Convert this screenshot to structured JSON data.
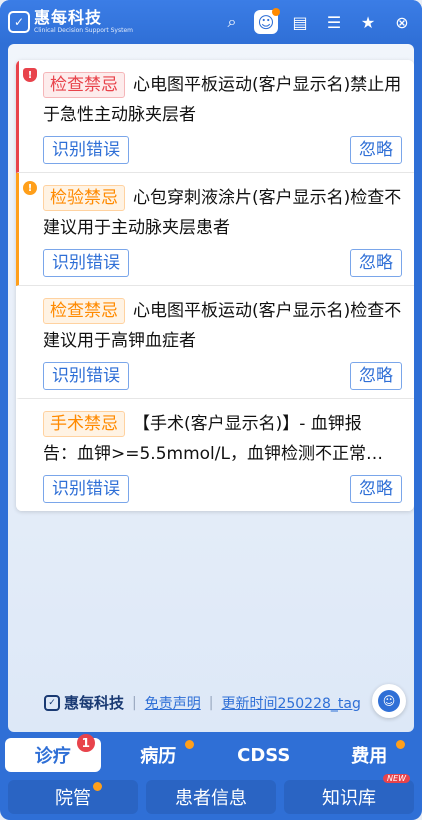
{
  "app": {
    "name": "惠每科技",
    "subtitle": "Clinical Decision Support System"
  },
  "toolbar": {
    "icons": [
      "search-icon",
      "cdss-bot-icon",
      "document-icon",
      "form-icon",
      "star-icon",
      "close-icon"
    ]
  },
  "alerts": [
    {
      "tag": "检查禁忌",
      "severity": "red",
      "text": "心电图平板运动(客户显示名)禁止用于急性主动脉夹层者",
      "btn_error": "识别错误",
      "btn_ignore": "忽略"
    },
    {
      "tag": "检验禁忌",
      "severity": "orange",
      "text": "心包穿刺液涂片(客户显示名)检查不建议用于主动脉夹层患者",
      "btn_error": "识别错误",
      "btn_ignore": "忽略"
    },
    {
      "tag": "检查禁忌",
      "severity": "orange",
      "text": "心电图平板运动(客户显示名)检查不建议用于高钾血症者",
      "btn_error": "识别错误",
      "btn_ignore": "忽略"
    },
    {
      "tag": "手术禁忌",
      "severity": "orange",
      "text_line1": "【手术(客户显示名)】- 血钾报",
      "text_line2": "告：血钾>=5.5mmol/L，血钾检测不正常…",
      "btn_error": "识别错误",
      "btn_ignore": "忽略"
    }
  ],
  "footer": {
    "logo": "惠每科技",
    "disclaimer": "免责声明",
    "update": "更新时间250228_tag"
  },
  "tabs_row1": [
    {
      "label": "诊疗",
      "badge": "1",
      "active": true
    },
    {
      "label": "病历",
      "dot": true
    },
    {
      "label": "CDSS"
    },
    {
      "label": "费用",
      "dot": true
    }
  ],
  "tabs_row2": [
    {
      "label": "院管",
      "dot": true
    },
    {
      "label": "患者信息"
    },
    {
      "label": "知识库",
      "new": "NEW"
    }
  ],
  "colors": {
    "primary": "#2f6fd6",
    "danger": "#e8434b",
    "warning": "#ff9f1a"
  }
}
